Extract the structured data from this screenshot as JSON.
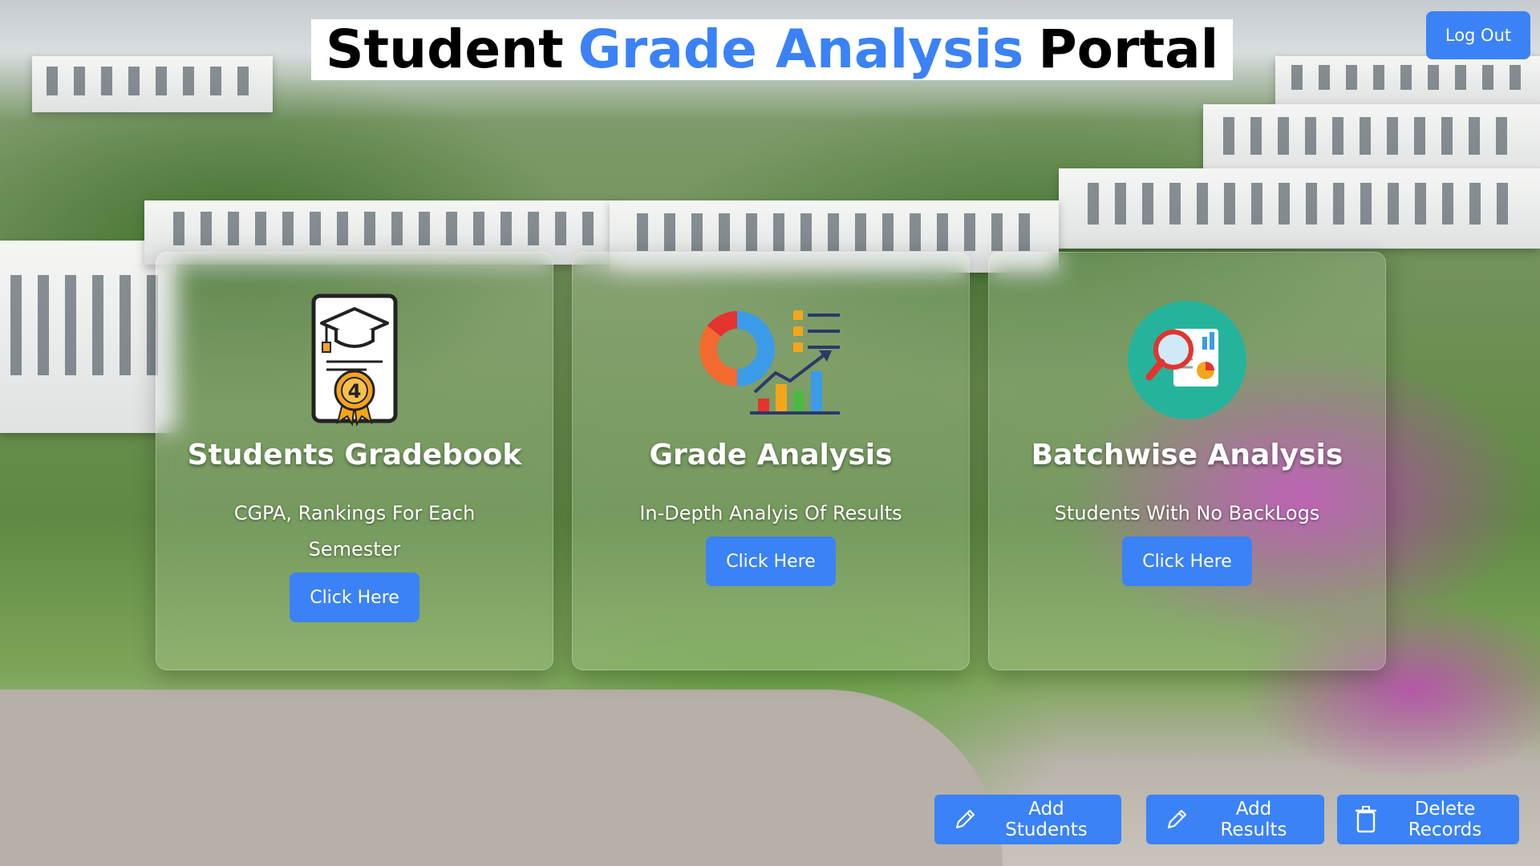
{
  "header": {
    "title_part1": "Student",
    "title_part2": "Grade Analysis",
    "title_part3": "Portal",
    "logout_label": "Log Out"
  },
  "cards": [
    {
      "title": "Students Gradebook",
      "description": "CGPA, Rankings For Each Semester",
      "button_label": "Click Here",
      "icon": "gradebook-certificate-icon",
      "icon_badge": "4"
    },
    {
      "title": "Grade Analysis",
      "description": "In-Depth Analyis Of Results",
      "button_label": "Click Here",
      "icon": "chart-analysis-icon"
    },
    {
      "title": "Batchwise Analysis",
      "description": "Students With No BackLogs",
      "button_label": "Click Here",
      "icon": "magnifier-report-icon"
    }
  ],
  "actions": {
    "add_students": "Add Students",
    "add_results": "Add Results",
    "delete_records": "Delete Records"
  },
  "colors": {
    "accent": "#3b82f6",
    "title_bg": "#ffffff",
    "title_text": "#000000"
  }
}
